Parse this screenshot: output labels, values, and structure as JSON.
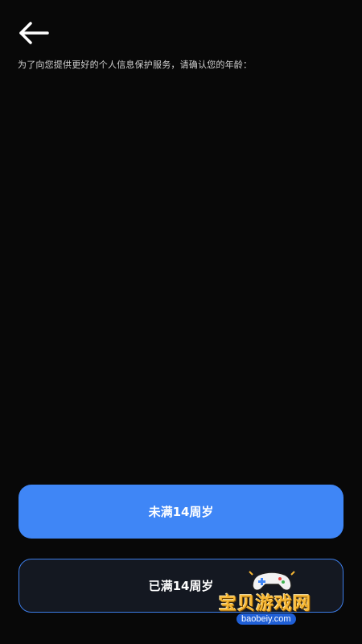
{
  "header": {
    "back_icon": "arrow-left-icon"
  },
  "prompt": {
    "text": "为了向您提供更好的个人信息保护服务，请确认您的年龄："
  },
  "age_options": {
    "under_label": "未满14周岁",
    "over_label": "已满14周岁"
  },
  "colors": {
    "background": "#080808",
    "primary_button": "#3f86f6",
    "secondary_button_bg": "#141821",
    "secondary_button_border": "#3d7de8"
  },
  "watermark": {
    "title": "宝贝游戏网",
    "url": "baobeiy.com",
    "icon": "game-controller-icon"
  }
}
